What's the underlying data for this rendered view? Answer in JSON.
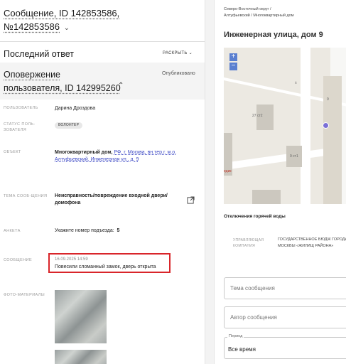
{
  "request": {
    "title_line1": "Сообщение, ID 142853586,",
    "title_line2": "№142853586",
    "chevron": "⌄"
  },
  "last_reply": {
    "heading": "Последний ответ",
    "expand_label": "РАСКРЫТЬ ⌄"
  },
  "notification": {
    "title_line1": "Оповержение",
    "title_line2": "пользователя, ID 142995260",
    "chevron": "⌃",
    "status": "Опубликовано"
  },
  "fields": {
    "user_label": "ПОЛЬЗОВАТЕЛЬ",
    "user_value": "Дарина Дроздова",
    "status_label": "СТАТУС ПОЛЬ-ЗОВАТЕЛЯ",
    "status_value": "ВОЛОНТЕР",
    "object_label": "ОБЪЕКТ",
    "object_value_prefix": "Многоквартирный дом,",
    "object_value_link": "РФ, г. Москва, вн.тер.г. м.о. Алтуфьевский, Инженерная ул., д. 9",
    "topic_label": "ТЕМА СООБ-ЩЕНИЯ",
    "topic_value": "Неисправность/повреждение входной двери/домофона",
    "form_label": "АНКЕТА",
    "form_value": "Укажите номер подъезда:",
    "form_answer": "5",
    "message_label": "СООБЩЕНИЕ",
    "message_date": "16.09.2025 14:59",
    "message_text": "Повесили сломанный замок, дверь открыта",
    "photos_label": "ФОТО-МАТЕРИАЛЫ"
  },
  "right": {
    "breadcrumb_line1": "Северо-Восточный округ /",
    "breadcrumb_line2": "Алтуфьевский / Многоквартирный дом",
    "address_title": "Инженерная улица, дом 9",
    "map": {
      "zoom_in": "+",
      "zoom_out": "−",
      "label_27": "27 ст2",
      "label_9": "9",
      "label_9c1": "9 ст1",
      "label_edge": "едик",
      "label_plusminus": "±"
    },
    "outage_heading": "Отключения горячей воды",
    "company_label": "УПРАВЛЯЮЩАЯ КОМПАНИЯ",
    "company_value": "ГОСУДАРСТВЕННОЕ БЮДЖ ГОРОДА МОСКВЫ «ЖИЛИЩ РАЙОНА»",
    "topic_placeholder": "Тема сообщения",
    "author_placeholder": "Автор сообщения",
    "period_label": "Период",
    "period_value": "Все время"
  },
  "colors": {
    "accent_link": "#3b47c4",
    "highlight_border": "#d9252a",
    "marker": "#7a6fd6",
    "zoom_button": "#5a7fd0"
  }
}
